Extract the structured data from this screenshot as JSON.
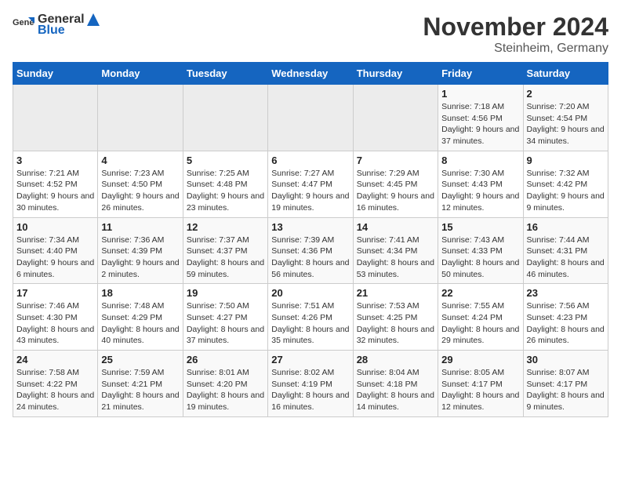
{
  "header": {
    "logo_general": "General",
    "logo_blue": "Blue",
    "month_title": "November 2024",
    "location": "Steinheim, Germany"
  },
  "days_of_week": [
    "Sunday",
    "Monday",
    "Tuesday",
    "Wednesday",
    "Thursday",
    "Friday",
    "Saturday"
  ],
  "weeks": [
    [
      {
        "day": "",
        "sunrise": "",
        "sunset": "",
        "daylight": "",
        "empty": true
      },
      {
        "day": "",
        "sunrise": "",
        "sunset": "",
        "daylight": "",
        "empty": true
      },
      {
        "day": "",
        "sunrise": "",
        "sunset": "",
        "daylight": "",
        "empty": true
      },
      {
        "day": "",
        "sunrise": "",
        "sunset": "",
        "daylight": "",
        "empty": true
      },
      {
        "day": "",
        "sunrise": "",
        "sunset": "",
        "daylight": "",
        "empty": true
      },
      {
        "day": "1",
        "sunrise": "Sunrise: 7:18 AM",
        "sunset": "Sunset: 4:56 PM",
        "daylight": "Daylight: 9 hours and 37 minutes.",
        "empty": false
      },
      {
        "day": "2",
        "sunrise": "Sunrise: 7:20 AM",
        "sunset": "Sunset: 4:54 PM",
        "daylight": "Daylight: 9 hours and 34 minutes.",
        "empty": false
      }
    ],
    [
      {
        "day": "3",
        "sunrise": "Sunrise: 7:21 AM",
        "sunset": "Sunset: 4:52 PM",
        "daylight": "Daylight: 9 hours and 30 minutes.",
        "empty": false
      },
      {
        "day": "4",
        "sunrise": "Sunrise: 7:23 AM",
        "sunset": "Sunset: 4:50 PM",
        "daylight": "Daylight: 9 hours and 26 minutes.",
        "empty": false
      },
      {
        "day": "5",
        "sunrise": "Sunrise: 7:25 AM",
        "sunset": "Sunset: 4:48 PM",
        "daylight": "Daylight: 9 hours and 23 minutes.",
        "empty": false
      },
      {
        "day": "6",
        "sunrise": "Sunrise: 7:27 AM",
        "sunset": "Sunset: 4:47 PM",
        "daylight": "Daylight: 9 hours and 19 minutes.",
        "empty": false
      },
      {
        "day": "7",
        "sunrise": "Sunrise: 7:29 AM",
        "sunset": "Sunset: 4:45 PM",
        "daylight": "Daylight: 9 hours and 16 minutes.",
        "empty": false
      },
      {
        "day": "8",
        "sunrise": "Sunrise: 7:30 AM",
        "sunset": "Sunset: 4:43 PM",
        "daylight": "Daylight: 9 hours and 12 minutes.",
        "empty": false
      },
      {
        "day": "9",
        "sunrise": "Sunrise: 7:32 AM",
        "sunset": "Sunset: 4:42 PM",
        "daylight": "Daylight: 9 hours and 9 minutes.",
        "empty": false
      }
    ],
    [
      {
        "day": "10",
        "sunrise": "Sunrise: 7:34 AM",
        "sunset": "Sunset: 4:40 PM",
        "daylight": "Daylight: 9 hours and 6 minutes.",
        "empty": false
      },
      {
        "day": "11",
        "sunrise": "Sunrise: 7:36 AM",
        "sunset": "Sunset: 4:39 PM",
        "daylight": "Daylight: 9 hours and 2 minutes.",
        "empty": false
      },
      {
        "day": "12",
        "sunrise": "Sunrise: 7:37 AM",
        "sunset": "Sunset: 4:37 PM",
        "daylight": "Daylight: 8 hours and 59 minutes.",
        "empty": false
      },
      {
        "day": "13",
        "sunrise": "Sunrise: 7:39 AM",
        "sunset": "Sunset: 4:36 PM",
        "daylight": "Daylight: 8 hours and 56 minutes.",
        "empty": false
      },
      {
        "day": "14",
        "sunrise": "Sunrise: 7:41 AM",
        "sunset": "Sunset: 4:34 PM",
        "daylight": "Daylight: 8 hours and 53 minutes.",
        "empty": false
      },
      {
        "day": "15",
        "sunrise": "Sunrise: 7:43 AM",
        "sunset": "Sunset: 4:33 PM",
        "daylight": "Daylight: 8 hours and 50 minutes.",
        "empty": false
      },
      {
        "day": "16",
        "sunrise": "Sunrise: 7:44 AM",
        "sunset": "Sunset: 4:31 PM",
        "daylight": "Daylight: 8 hours and 46 minutes.",
        "empty": false
      }
    ],
    [
      {
        "day": "17",
        "sunrise": "Sunrise: 7:46 AM",
        "sunset": "Sunset: 4:30 PM",
        "daylight": "Daylight: 8 hours and 43 minutes.",
        "empty": false
      },
      {
        "day": "18",
        "sunrise": "Sunrise: 7:48 AM",
        "sunset": "Sunset: 4:29 PM",
        "daylight": "Daylight: 8 hours and 40 minutes.",
        "empty": false
      },
      {
        "day": "19",
        "sunrise": "Sunrise: 7:50 AM",
        "sunset": "Sunset: 4:27 PM",
        "daylight": "Daylight: 8 hours and 37 minutes.",
        "empty": false
      },
      {
        "day": "20",
        "sunrise": "Sunrise: 7:51 AM",
        "sunset": "Sunset: 4:26 PM",
        "daylight": "Daylight: 8 hours and 35 minutes.",
        "empty": false
      },
      {
        "day": "21",
        "sunrise": "Sunrise: 7:53 AM",
        "sunset": "Sunset: 4:25 PM",
        "daylight": "Daylight: 8 hours and 32 minutes.",
        "empty": false
      },
      {
        "day": "22",
        "sunrise": "Sunrise: 7:55 AM",
        "sunset": "Sunset: 4:24 PM",
        "daylight": "Daylight: 8 hours and 29 minutes.",
        "empty": false
      },
      {
        "day": "23",
        "sunrise": "Sunrise: 7:56 AM",
        "sunset": "Sunset: 4:23 PM",
        "daylight": "Daylight: 8 hours and 26 minutes.",
        "empty": false
      }
    ],
    [
      {
        "day": "24",
        "sunrise": "Sunrise: 7:58 AM",
        "sunset": "Sunset: 4:22 PM",
        "daylight": "Daylight: 8 hours and 24 minutes.",
        "empty": false
      },
      {
        "day": "25",
        "sunrise": "Sunrise: 7:59 AM",
        "sunset": "Sunset: 4:21 PM",
        "daylight": "Daylight: 8 hours and 21 minutes.",
        "empty": false
      },
      {
        "day": "26",
        "sunrise": "Sunrise: 8:01 AM",
        "sunset": "Sunset: 4:20 PM",
        "daylight": "Daylight: 8 hours and 19 minutes.",
        "empty": false
      },
      {
        "day": "27",
        "sunrise": "Sunrise: 8:02 AM",
        "sunset": "Sunset: 4:19 PM",
        "daylight": "Daylight: 8 hours and 16 minutes.",
        "empty": false
      },
      {
        "day": "28",
        "sunrise": "Sunrise: 8:04 AM",
        "sunset": "Sunset: 4:18 PM",
        "daylight": "Daylight: 8 hours and 14 minutes.",
        "empty": false
      },
      {
        "day": "29",
        "sunrise": "Sunrise: 8:05 AM",
        "sunset": "Sunset: 4:17 PM",
        "daylight": "Daylight: 8 hours and 12 minutes.",
        "empty": false
      },
      {
        "day": "30",
        "sunrise": "Sunrise: 8:07 AM",
        "sunset": "Sunset: 4:17 PM",
        "daylight": "Daylight: 8 hours and 9 minutes.",
        "empty": false
      }
    ]
  ]
}
